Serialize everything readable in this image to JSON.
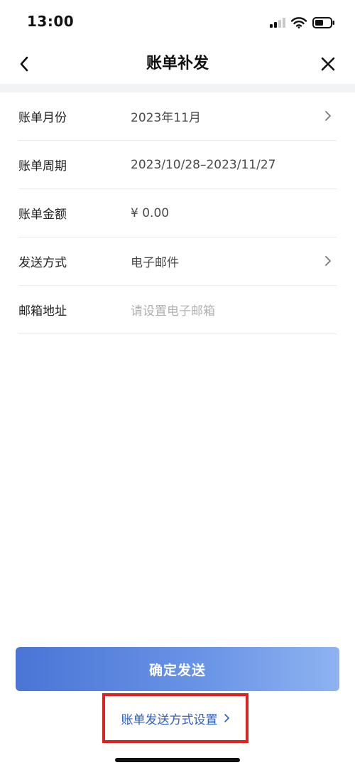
{
  "status_bar": {
    "time": "13:00",
    "icons": [
      "signal-icon",
      "wifi-icon",
      "battery-icon"
    ]
  },
  "nav": {
    "title": "账单补发",
    "back_icon": "chevron-left-icon",
    "close_icon": "close-icon"
  },
  "form": {
    "rows": [
      {
        "label": "账单月份",
        "value": "2023年11月",
        "has_chevron": true
      },
      {
        "label": "账单周期",
        "value": "2023/10/28–2023/11/27",
        "has_chevron": false
      },
      {
        "label": "账单金额",
        "value": "¥ 0.00",
        "has_chevron": false
      },
      {
        "label": "发送方式",
        "value": "电子邮件",
        "has_chevron": true
      },
      {
        "label": "邮箱地址",
        "placeholder": "请设置电子邮箱",
        "has_chevron": false
      }
    ]
  },
  "actions": {
    "confirm_label": "确定发送",
    "settings_link_label": "账单发送方式设置"
  },
  "colors": {
    "accent_start": "#4a75d6",
    "accent_end": "#8fb3f1",
    "link": "#2f5fb8",
    "highlight_border": "#e0221f"
  }
}
